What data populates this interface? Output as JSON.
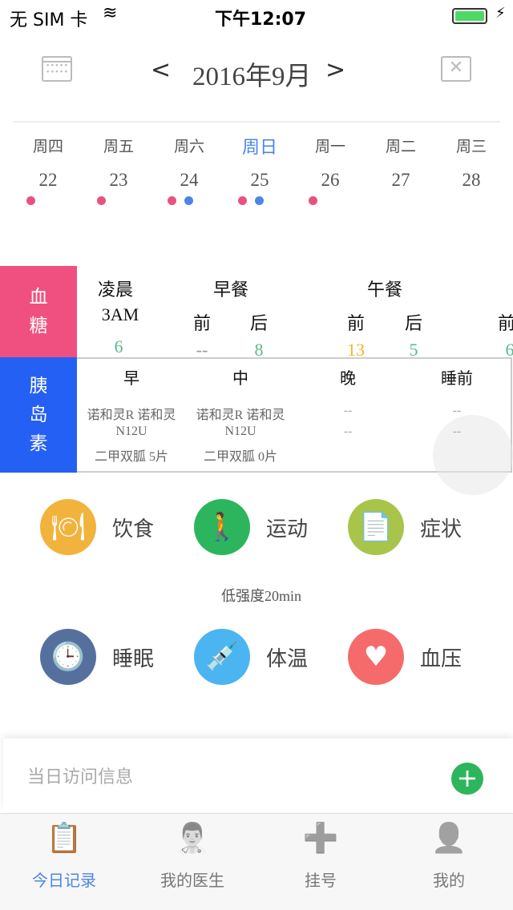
{
  "status": {
    "carrier": "无 SIM 卡",
    "time": "下午12:07"
  },
  "header": {
    "prev": "<",
    "title": "2016年9月",
    "next": ">"
  },
  "week": {
    "days": [
      {
        "wd": "周四",
        "d": "22",
        "dots": [
          "#e8527f"
        ]
      },
      {
        "wd": "周五",
        "d": "23",
        "dots": [
          "#e8527f"
        ]
      },
      {
        "wd": "周六",
        "d": "24",
        "dots": [
          "#e8527f",
          "#4a86e8"
        ]
      },
      {
        "wd": "周日",
        "d": "25",
        "dots": [
          "#e8527f",
          "#4a86e8"
        ],
        "selected": true
      },
      {
        "wd": "周一",
        "d": "26",
        "dots": [
          "#e8527f"
        ]
      },
      {
        "wd": "周二",
        "d": "27",
        "dots": []
      },
      {
        "wd": "周三",
        "d": "28",
        "dots": []
      }
    ]
  },
  "glucose": {
    "label1": "血",
    "label2": "糖",
    "groups": [
      "凌晨",
      "早餐",
      "午餐"
    ],
    "sub": [
      "3AM",
      "前",
      "后",
      "前",
      "后",
      "前"
    ],
    "values": [
      "6",
      "--",
      "8",
      "13",
      "5",
      "6"
    ],
    "value_colors": [
      "#5bb98c",
      "#999",
      "#5bb98c",
      "#e8b923",
      "#5bb98c",
      "#5bb98c"
    ],
    "color": "#f0507f"
  },
  "insulin": {
    "label1": "胰",
    "label2": "岛",
    "label3": "素",
    "cols": [
      "早",
      "中",
      "晚",
      "睡前"
    ],
    "cells": [
      [
        "诺和灵R 诺和灵",
        "N12U",
        "二甲双胍 5片"
      ],
      [
        "诺和灵R 诺和灵",
        "N12U",
        "二甲双胍 0片"
      ],
      [
        "--",
        "--",
        ""
      ],
      [
        "--",
        "--",
        ""
      ]
    ],
    "color": "#2560f5"
  },
  "actions": [
    {
      "label": "饮食",
      "icon": "plate-icon",
      "color": "#f2b33d"
    },
    {
      "label": "运动",
      "icon": "walking-icon",
      "color": "#2db55d",
      "sub": "低强度20min"
    },
    {
      "label": "症状",
      "icon": "document-icon",
      "color": "#a8c44a"
    },
    {
      "label": "睡眠",
      "icon": "clock-icon",
      "color": "#56709e"
    },
    {
      "label": "体温",
      "icon": "dropper-icon",
      "color": "#4ab5f0"
    },
    {
      "label": "血压",
      "icon": "heart-icon",
      "color": "#f56b6b"
    }
  ],
  "visit": {
    "placeholder": "当日访问信息",
    "add_color": "#2db55d"
  },
  "tabs": [
    {
      "label": "今日记录",
      "active": true
    },
    {
      "label": "我的医生"
    },
    {
      "label": "挂号"
    },
    {
      "label": "我的"
    }
  ],
  "accent": "#4a86e8"
}
